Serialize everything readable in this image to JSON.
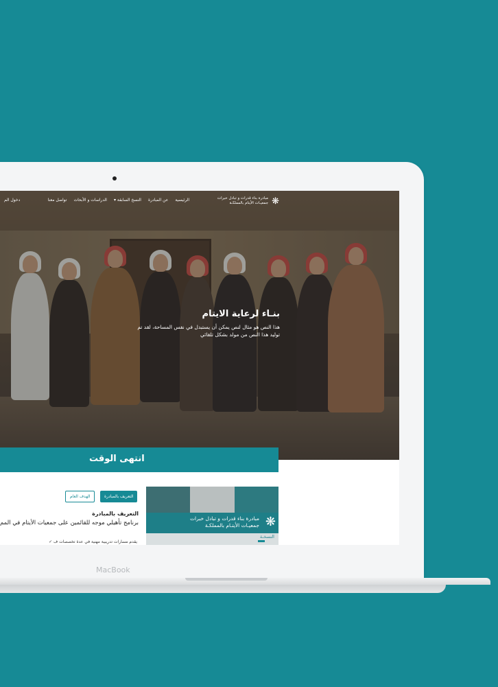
{
  "nav": {
    "logo_text_line1": "مبادرة بناء قدرات و تبادل خبرات",
    "logo_text_line2": "جمعيـات الأيتام بالمملكـة",
    "items": [
      "الرئيسية",
      "عن المبادرة",
      "النسخ السابقة ▾",
      "الدراسات و الأبحاث",
      "تواصل معنا"
    ],
    "login_label": "دخول الم"
  },
  "hero": {
    "title": "بنـاء لرعاية الايتام",
    "description": "هذا النص هو مثال لنص يمكن أن يستبدل في نفس المساحة، لقد تم توليد هذا النص من مولد بشكل تلقائي"
  },
  "countdown": {
    "label": "انتهى الوقت"
  },
  "card": {
    "banner_line1": "مبادرة بناء قدرات و تبادل خبرات",
    "banner_line2": "جمعيـات الأيتـام بالمملكـة",
    "edition_label": "النسخـة"
  },
  "tabs": {
    "intro_label": "التعريف بالمبادرة",
    "goal_label": "الهدف العام"
  },
  "section": {
    "heading": "التعريف بالمبادرة",
    "description": "برنامج تأهيلي موجه للقائمين على جمعيات الأيتام في المم",
    "bullet": "✓ يقدم مسارات تدريبية مهنية في عدة تخصصات ف"
  },
  "device": {
    "brand": "MacBook"
  },
  "colors": {
    "accent": "#168a95",
    "background": "#168a95"
  }
}
